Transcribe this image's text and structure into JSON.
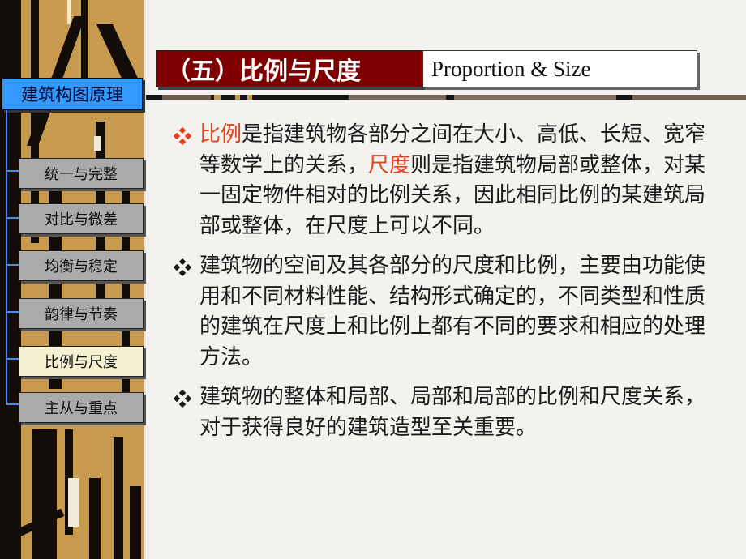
{
  "sidebar": {
    "title": "建筑构图原理",
    "items": [
      {
        "label": "统一与完整",
        "active": false
      },
      {
        "label": "对比与微差",
        "active": false
      },
      {
        "label": "均衡与稳定",
        "active": false
      },
      {
        "label": "韵律与节奏",
        "active": false
      },
      {
        "label": "比例与尺度",
        "active": true
      },
      {
        "label": "主从与重点",
        "active": false
      }
    ]
  },
  "header": {
    "title_cn": "（五）比例与尺度",
    "title_en": "Proportion & Size"
  },
  "colors": {
    "header_bg": "#7f0000",
    "nav_title_bg": "#3399ff",
    "nav_item_bg": "#aaaaaa",
    "nav_active_bg": "#f5f1d0",
    "highlight": "#e8401c",
    "bullet_first": "#e8401c",
    "bullet_other": "#1a1a1a"
  },
  "bullets": [
    {
      "icon": "four-diamond-bullet-icon",
      "segments": [
        {
          "text": "比例",
          "highlight": true
        },
        {
          "text": "是指建筑物各部分之间在大小、高低、长短、宽窄等数学上的关系，",
          "highlight": false
        },
        {
          "text": "尺度",
          "highlight": true
        },
        {
          "text": "则是指建筑物局部或整体，对某一固定物件相对的比例关系，因此相同比例的某建筑局部或整体，在尺度上可以不同。",
          "highlight": false
        }
      ]
    },
    {
      "icon": "four-diamond-bullet-icon",
      "segments": [
        {
          "text": "建筑物的空间及其各部分的尺度和比例，主要由功能使用和不同材料性能、结构形式确定的，不同类型和性质的建筑在尺度上和比例上都有不同的要求和相应的处理方法。",
          "highlight": false
        }
      ]
    },
    {
      "icon": "four-diamond-bullet-icon",
      "segments": [
        {
          "text": "建筑物的整体和局部、局部和局部的比例和尺度关系，对于获得良好的建筑造型至关重要。",
          "highlight": false
        }
      ]
    }
  ]
}
